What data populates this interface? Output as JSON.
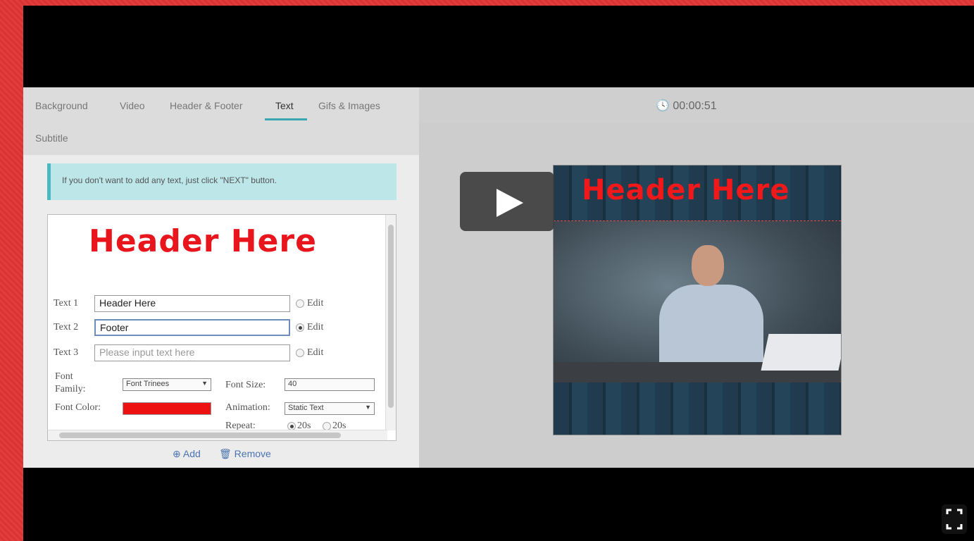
{
  "tabs": [
    {
      "label": "Background"
    },
    {
      "label": "Video"
    },
    {
      "label": "Header & Footer"
    },
    {
      "label": "Text"
    },
    {
      "label": "Gifs & Images"
    },
    {
      "label": "Subtitle"
    }
  ],
  "timer": "00:00:51",
  "notice": "If you don't want to add any text, just click \"NEXT\" button.",
  "preview_header": "Header Here",
  "texts": [
    {
      "label": "Text 1",
      "value": "Header Here",
      "edit_label": "Edit"
    },
    {
      "label": "Text 2",
      "value": "Footer",
      "edit_label": "Edit"
    },
    {
      "label": "Text 3",
      "placeholder": "Please input text here",
      "edit_label": "Edit"
    }
  ],
  "font_family": {
    "label_line1": "Font",
    "label_line2": "Family:",
    "value": "Font Trinees"
  },
  "font_size": {
    "label": "Font Size:",
    "value": "40"
  },
  "font_color": {
    "label": "Font Color:",
    "value": "#ee1111"
  },
  "animation": {
    "label": "Animation:",
    "value": "Static Text"
  },
  "repeat": {
    "label": "Repeat:",
    "opt1": "20s",
    "opt2": "20s"
  },
  "actions": {
    "add": "Add",
    "remove": "Remove"
  },
  "thumbnail": {
    "header": "Header Here"
  }
}
